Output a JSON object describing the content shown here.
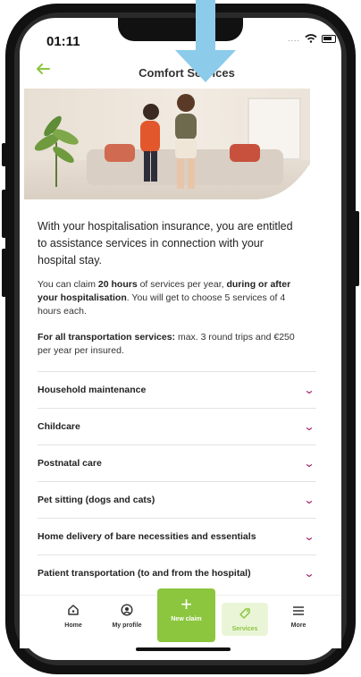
{
  "status_bar": {
    "time": "01:11",
    "signal": "....",
    "wifi_icon": "wifi-icon",
    "battery_icon": "battery-icon"
  },
  "header": {
    "back_icon": "arrow-left-icon",
    "title": "Comfort Services"
  },
  "intro": "With your hospitalisation insurance, you are entitled to assistance services in connection with your hospital stay.",
  "claim_text": {
    "part1": "You can claim ",
    "bold1": "20 hours",
    "part2": " of services per year, ",
    "bold2": "during or after your hospitalisation",
    "part3": ". You will get to choose 5 services of 4 hours each."
  },
  "transport_text": {
    "bold": "For all transportation services:",
    "rest": " max. 3 round trips and €250 per year per insured."
  },
  "services": [
    {
      "label": "Household maintenance"
    },
    {
      "label": "Childcare"
    },
    {
      "label": "Postnatal care"
    },
    {
      "label": "Pet sitting (dogs and cats)"
    },
    {
      "label": "Home delivery of bare necessities and essentials"
    },
    {
      "label": "Patient transportation (to and from the hospital)"
    }
  ],
  "nav": {
    "home": "Home",
    "profile": "My profile",
    "new_claim": "New claim",
    "services": "Services",
    "more": "More"
  },
  "colors": {
    "accent_green": "#8cc63f",
    "chevron_magenta": "#a1156b",
    "arrow_blue": "#8ccbea"
  }
}
